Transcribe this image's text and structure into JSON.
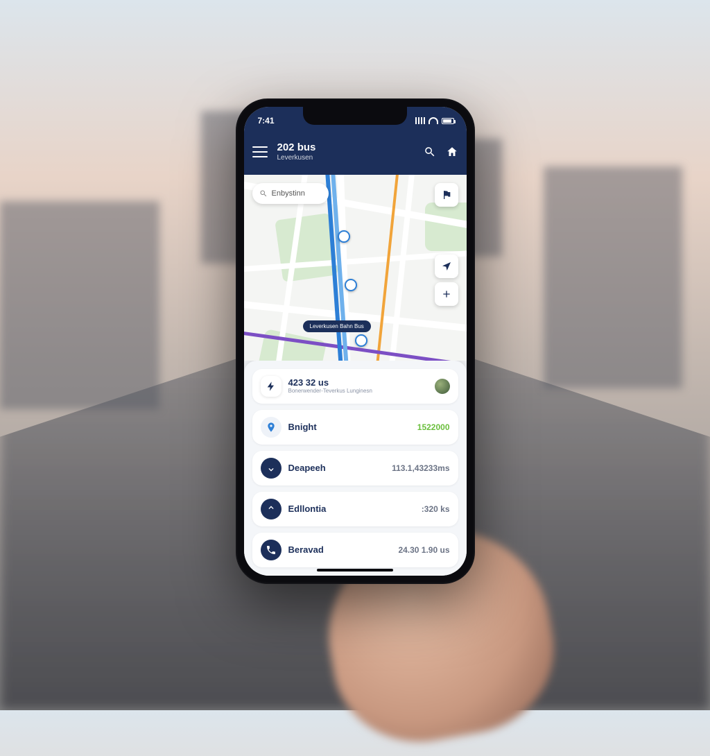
{
  "status": {
    "time": "7:41"
  },
  "header": {
    "title": "202 bus",
    "subtitle": "Leverkusen"
  },
  "map": {
    "search_placeholder": "Enbystinn",
    "stop_label": "Leverkusen Bahn Bus"
  },
  "route_header": {
    "title": "423 32 us",
    "subtitle": "Bonerwender-Teverkus Lunginesn"
  },
  "stops": [
    {
      "icon": "pin",
      "name": "Bnight",
      "value": "1522000",
      "highlight": true
    },
    {
      "icon": "down",
      "name": "Deapeeh",
      "value": "113.1,43233ms",
      "highlight": false
    },
    {
      "icon": "up",
      "name": "Edllontia",
      "value": ":320 ks",
      "highlight": false
    },
    {
      "icon": "phone",
      "name": "Beravad",
      "value": "24.30 1.90 us",
      "highlight": false
    }
  ]
}
